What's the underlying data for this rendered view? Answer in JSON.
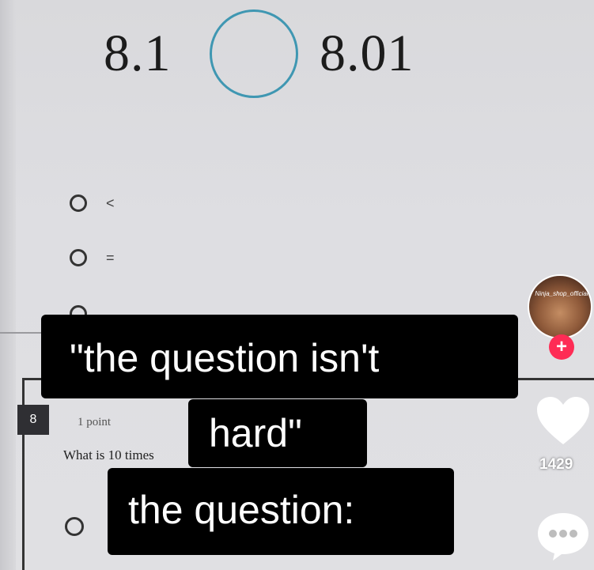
{
  "question": {
    "left_number": "8.1",
    "right_number": "8.01",
    "options": [
      {
        "label": "<"
      },
      {
        "label": "="
      }
    ]
  },
  "question8": {
    "number": "8",
    "points": "1 point",
    "text": "What is 10 times"
  },
  "captions": {
    "line1": "\"the question isn't",
    "line2": "hard\"",
    "line3": "the question:"
  },
  "sidebar": {
    "avatar_name": "Ninja_shop_official",
    "follow_symbol": "+",
    "like_count": "1429",
    "icons": {
      "follow": "plus-icon",
      "like": "heart-icon",
      "comment": "comment-dots-icon"
    }
  },
  "colors": {
    "blank_circle": "#3f97b2",
    "follow": "#fe2c55",
    "caption_bg": "#000000"
  }
}
